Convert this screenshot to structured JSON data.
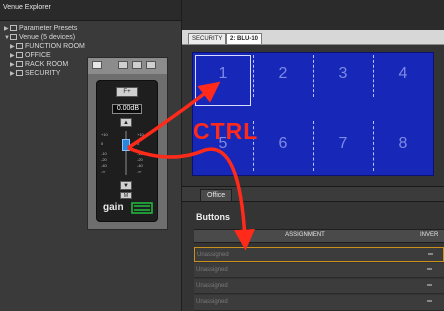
{
  "left_panel": {
    "title": "Venue Explorer",
    "tree": [
      {
        "label": "Parameter Presets",
        "expanded": false
      },
      {
        "label": "Venue (5 devices)",
        "expanded": true
      },
      {
        "label": "FUNCTION ROOM",
        "expanded": false
      },
      {
        "label": "OFFICE",
        "expanded": false
      },
      {
        "label": "RACK ROOM",
        "expanded": false
      },
      {
        "label": "SECURITY",
        "expanded": false
      }
    ]
  },
  "gain_window": {
    "value": "0.00dB",
    "btn_f_plus": "F+",
    "btn_m": "M",
    "brand": "gain",
    "scale_left": [
      "+10",
      "0",
      "-10",
      "-20",
      "-40",
      "-∞"
    ],
    "scale_right": [
      "+10",
      "0",
      "-10",
      "-20",
      "-40",
      "-∞"
    ]
  },
  "tabs": [
    {
      "label": "SECURITY",
      "active": false
    },
    {
      "label": "2: BLU-10",
      "active": true
    }
  ],
  "grid": {
    "cells": [
      "1",
      "2",
      "3",
      "4",
      "5",
      "6",
      "7",
      "8"
    ],
    "selected": "1"
  },
  "office_tab": "Office",
  "buttons_section": {
    "title": "Buttons",
    "col_assignment": "ASSIGNMENT",
    "col_invert": "INVER",
    "rows": [
      "Unassigned",
      "Unassigned",
      "Unassigned",
      "Unassigned"
    ]
  },
  "overlay_text": "CTRL",
  "colors": {
    "grid_blue": "#1727b8",
    "ctrl_red": "#ff2a1a",
    "slider_blue": "#2a86d9",
    "selected_row_border": "#c9911c"
  }
}
